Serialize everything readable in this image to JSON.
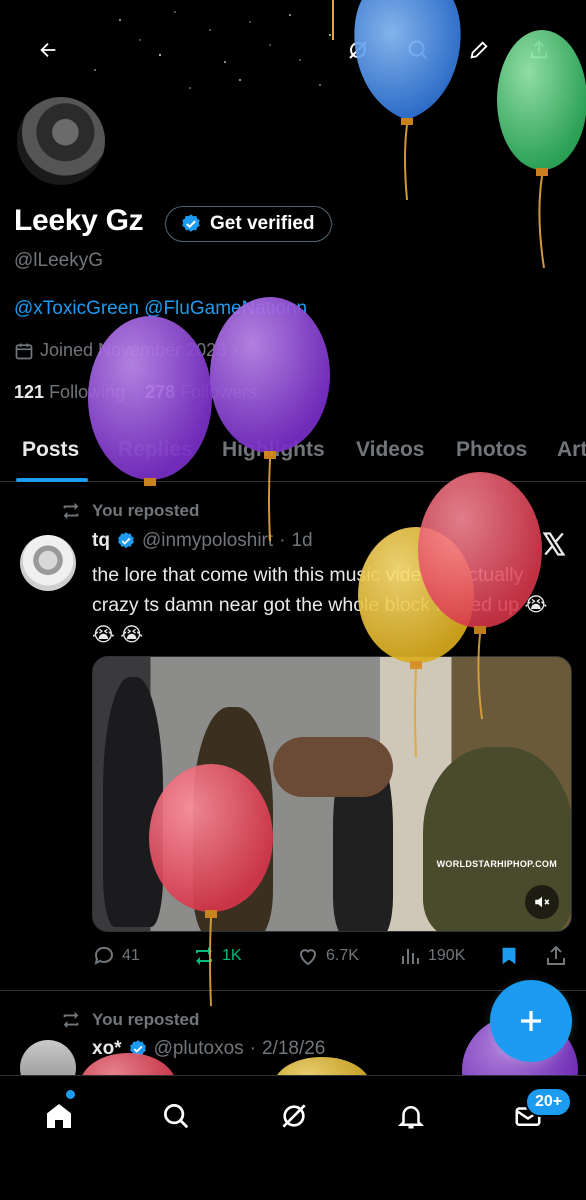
{
  "profile": {
    "name": "Leeky Gz",
    "get_verified_label": "Get verified",
    "handle": "@lLeekyG",
    "bio_mentions": "@xToxicGreen @FluGameNationn",
    "joined": "Joined November 2023",
    "following_count": "121",
    "following_label": "Following",
    "followers_count": "278",
    "followers_label": "Followers"
  },
  "tabs": [
    {
      "label": "Posts"
    },
    {
      "label": "Replies"
    },
    {
      "label": "Highlights"
    },
    {
      "label": "Videos"
    },
    {
      "label": "Photos"
    },
    {
      "label": "Art"
    }
  ],
  "posts": [
    {
      "repost_label": "You reposted",
      "author": "tq",
      "handle": "@inmypoloshirt",
      "time": "1d",
      "text": "the lore that come with this music video is actually crazy ts damn near got the whole block locked up 😭 😭 😭",
      "media_watermark": "WORLDSTARHIPHOP.COM",
      "replies": "41",
      "reposts": "1K",
      "likes": "6.7K",
      "views": "190K"
    },
    {
      "repost_label": "You reposted",
      "author": "xo*",
      "handle": "@plutoxos",
      "time": "2/18/26"
    }
  ],
  "nav": {
    "messages_badge": "20+"
  },
  "colors": {
    "accent": "#1d9bf0",
    "repost_green": "#00ba7c",
    "muted": "#71767b"
  }
}
